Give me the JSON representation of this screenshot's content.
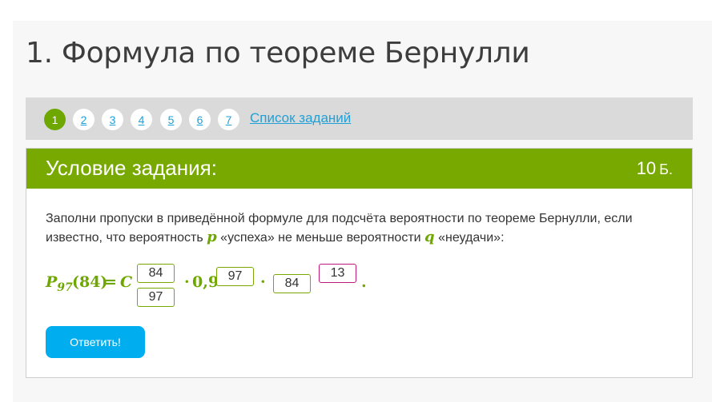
{
  "page": {
    "title": "1. Формула по теореме Бернулли"
  },
  "task_nav": {
    "tasks": [
      {
        "label": "1",
        "active": true
      },
      {
        "label": "2",
        "active": false
      },
      {
        "label": "3",
        "active": false
      },
      {
        "label": "4",
        "active": false
      },
      {
        "label": "5",
        "active": false
      },
      {
        "label": "6",
        "active": false
      },
      {
        "label": "7",
        "active": false
      }
    ],
    "task_list_link": "Список заданий"
  },
  "panel": {
    "title": "Условие задания:",
    "points_value": "10",
    "points_unit": "Б."
  },
  "task": {
    "text_part1": "Заполни пропуски в приведённой формуле для подсчёта вероятности по теореме Бернулли, если известно, что вероятность ",
    "var_p": "p",
    "text_part2": " «успеха» не меньше вероятности ",
    "var_q": "q",
    "text_part3": " «неудачи»:"
  },
  "formula": {
    "P": "P",
    "P_sub": "97",
    "paren": "(84)",
    "equals": "=",
    "C": "C",
    "dot1": "·",
    "base": "0,9",
    "dot2": "·",
    "end": ".",
    "inputs": {
      "c_top": "84",
      "c_bottom": "97",
      "exp1": "97",
      "base2": "84",
      "exp2": "13"
    }
  },
  "actions": {
    "answer_label": "Ответить!"
  },
  "colors": {
    "accent_green": "#78a900",
    "link_blue": "#1ea0d8",
    "button_blue": "#00aef0",
    "pink_border": "#c2187a"
  }
}
